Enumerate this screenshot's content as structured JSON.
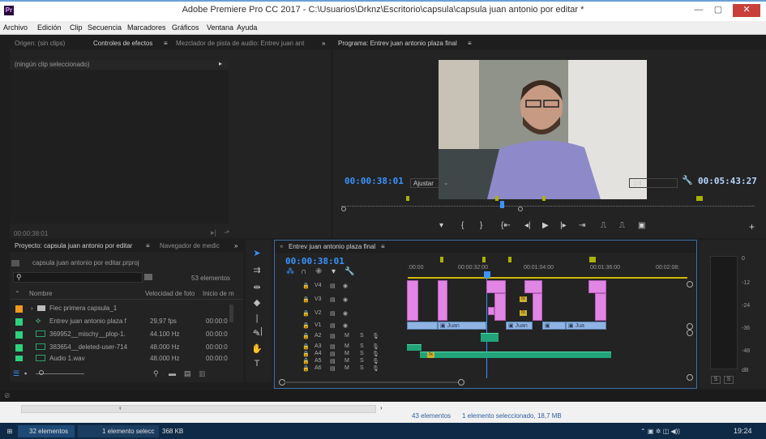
{
  "window": {
    "title": "Adobe Premiere Pro CC 2017 - C:\\Usuarios\\Drknz\\Escritorio\\capsula\\capsula juan antonio por editar *",
    "logo": "Pr"
  },
  "menu": [
    "Archivo",
    "Edición",
    "Clip",
    "Secuencia",
    "Marcadores",
    "Gráficos",
    "Ventana",
    "Ayuda"
  ],
  "source_panel": {
    "tabs": [
      "Origen: (sin clips)",
      "Controles de efectos",
      "Mezclador de pista de audio: Entrev juan ant"
    ],
    "menu_icon": "≡",
    "overflow": "»",
    "no_clip": "(ningún clip seleccionado)",
    "timecode": "00:00:38:01"
  },
  "program_panel": {
    "title": "Programa: Entrev juan antonio plaza final",
    "menu_icon": "≡",
    "timecode": "00:00:38:01",
    "fit": "Ajustar",
    "resolution": "1/4",
    "duration": "00:05:43:27"
  },
  "project_panel": {
    "tabs": [
      "Proyecto: capsula juan antonio por editar",
      "Navegador de medic"
    ],
    "menu_icon": "≡",
    "overflow": "»",
    "project_file": "capsula juan antonio por editar.prproj",
    "count": "53 elementos",
    "columns": [
      "Nombre",
      "Velocidad de foto",
      "Inicio de m"
    ],
    "rows": [
      {
        "name": "Fiec primera capsula_1",
        "rate": "",
        "start": "",
        "color": "#f29a20"
      },
      {
        "name": "Entrev juan antonio plaza f",
        "rate": "29,97 fps",
        "start": "00:00:0",
        "color": "#2ed17c"
      },
      {
        "name": "369952__mischy__plop-1.",
        "rate": "44.100 Hz",
        "start": "00:00:0",
        "color": "#2ed17c"
      },
      {
        "name": "383654__deleted-user-714",
        "rate": "48.000 Hz",
        "start": "00:00:0",
        "color": "#2ed17c"
      },
      {
        "name": "Audio 1.wav",
        "rate": "48.000 Hz",
        "start": "00:00:0",
        "color": "#2ed17c"
      }
    ]
  },
  "timeline": {
    "title": "Entrev juan antonio plaza final",
    "menu_icon": "≡",
    "close": "×",
    "timecode": "00:00:38:01",
    "ruler": [
      ":00:00",
      "00:00:32:00",
      "00:01:04:00",
      "00:01:36:00",
      "00:02:08:"
    ],
    "tracks": [
      {
        "name": "V4",
        "kind": "video"
      },
      {
        "name": "V3",
        "kind": "video"
      },
      {
        "name": "V2",
        "kind": "video"
      },
      {
        "name": "V1",
        "kind": "video"
      },
      {
        "name": "A2",
        "kind": "audio"
      },
      {
        "name": "A3",
        "kind": "audio"
      },
      {
        "name": "A4",
        "kind": "audio"
      },
      {
        "name": "A5",
        "kind": "audio"
      },
      {
        "name": "A6",
        "kind": "audio"
      }
    ],
    "clip_labels": [
      "Juan",
      "Juan",
      "Jua"
    ],
    "fx_label": "fx",
    "ms_labels": {
      "m": "M",
      "s": "S"
    }
  },
  "audio_meter": {
    "scale": [
      "0",
      "-12",
      "-24",
      "-36",
      "-48",
      "dB"
    ],
    "buttons": [
      "S",
      "S"
    ]
  },
  "status_bar": {
    "items": "43 elementos",
    "selection": "1 elemento seleccionado, 18,7 MB"
  },
  "taskbar": {
    "folder_label": "32 elementos",
    "apps_label": "1 elemento selecc",
    "size_label": "368 KB",
    "clock": "19:24"
  },
  "colors": {
    "accent": "#3b93ff",
    "clip_video": "#e186e4",
    "clip_v1": "#8fb3e3",
    "clip_audio": "#21a479",
    "marker": "#a9b300"
  }
}
